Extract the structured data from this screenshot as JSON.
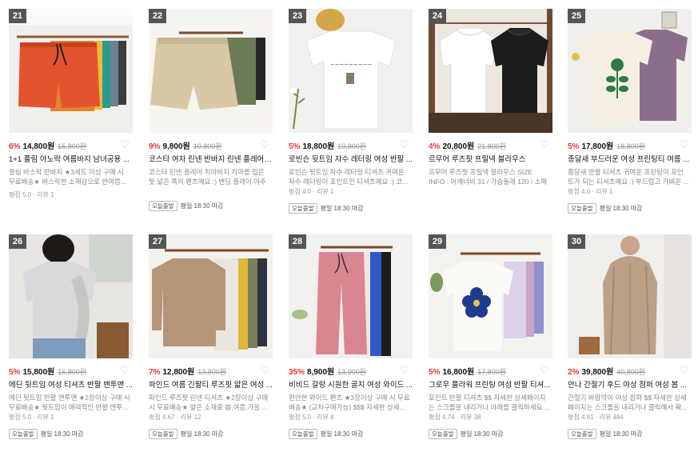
{
  "products": [
    {
      "rank": "21",
      "discount": "6%",
      "price": "14,800원",
      "original": "15,800원",
      "title": "1+1 플림 아노락 여름바지 남녀공용 ...",
      "desc": "플림 바스락 반바지 ★3세트 이상 구매 시 무료배송★ 바스락한 소재감으로 한여름...",
      "rating": "평점 5.0 · 리뷰 1",
      "badge": "",
      "delivery": ""
    },
    {
      "rank": "22",
      "discount": "9%",
      "price": "9,800원",
      "original": "10,800원",
      "title": "코스타 여자 린넨 반바지 린넨 플레어 치마...",
      "desc": "코스타 린넨 플레어 치마바지 치마를 입은 듯 넓은 폭의 팬츠예요 :) 밴딩 플레어 아주 ...",
      "rating": "",
      "badge": "오늘출발",
      "delivery": "평일 18:30 마감"
    },
    {
      "rank": "23",
      "discount": "5%",
      "price": "18,800원",
      "original": "19,800원",
      "title": "로빈슨 뒷트임 자수 레터링 여성 반팔 ...",
      "desc": "로빈슨 뒷트임 자수 레터링 티셔츠 귀여운 자수 레터링이 포인트인 티셔츠예요 :) 코...",
      "rating": "평점 4.0 · 리뷰 1",
      "badge": "오늘출발",
      "delivery": "평일 18:30 마감"
    },
    {
      "rank": "24",
      "discount": "4%",
      "price": "20,800원",
      "original": "21,800원",
      "title": "르무어 루즈핏 프릴넥 블라우스",
      "desc": "르무어 루즈핏 프릴넥 블라우스 SIZE INFO : 어깨너비 31 / 가슴둘레 120 / 소매길이 ...",
      "rating": "",
      "badge": "",
      "delivery": ""
    },
    {
      "rank": "25",
      "discount": "5%",
      "price": "17,800원",
      "original": "18,800원",
      "title": "종달새 부드러운 여성 프린팅티 여름 ...",
      "desc": "종달새 반팔 티셔츠 귀여운 프린팅이 포인트가 되는 티셔츠예요 :) 부드럽고 가벼운 ...",
      "rating": "평점 4.0 · 리뷰 1",
      "badge": "오늘출발",
      "delivery": "평일 18:30 마감"
    },
    {
      "rank": "26",
      "discount": "5%",
      "price": "15,800원",
      "original": "16,800원",
      "title": "에딘 뒷트임 여성 티셔츠 반팔 맨투맨 ...",
      "desc": "에딘 뒷트임 반팔 맨투맨 ★2장이상 구매 시 무료배송★ 뒷트임이 매력적인 반팔 맨투...",
      "rating": "평점 5.0 · 리뷰 1",
      "badge": "오늘출발",
      "delivery": "평일 18:30 마감"
    },
    {
      "rank": "27",
      "discount": "7%",
      "price": "12,800원",
      "original": "13,800원",
      "title": "파인드 여름 긴팔티 루즈핏 얇은 여성 ...",
      "desc": "파인드 루즈핏 린넨 티셔츠 ★2장이상 구매 시 무료배송★ 얇은 소재로 봄,여름,가을 ...",
      "rating": "평점 4.67 · 리뷰 12",
      "badge": "오늘출발",
      "delivery": "평일 18:30 마감"
    },
    {
      "rank": "28",
      "discount": "35%",
      "price": "8,900원",
      "original": "13,900원",
      "title": "비비드 갈랑 시원한 골지 여성 와이드 ...",
      "desc": "편안한 와이드 팬츠 ★3장이상 구매 시 무료배송★ (교차구매가능) $$$ 자세한 상세...",
      "rating": "평점 5.0 · 리뷰 8",
      "badge": "오늘출발",
      "delivery": "평일 18:30 마감"
    },
    {
      "rank": "29",
      "discount": "5%",
      "price": "16,800원",
      "original": "17,800원",
      "title": "그로우 플라워 프린팅 여성 반팔 티셔...",
      "desc": "포인트 반팔 티셔츠 $$ 자세한 상세페이지는 스크롤을 내리거나 아래를 클릭하세요 ...",
      "rating": "평점 4.74 · 리뷰 38",
      "badge": "오늘출발",
      "delivery": "평일 18:30 마감"
    },
    {
      "rank": "30",
      "discount": "2%",
      "price": "39,800원",
      "original": "40,800원",
      "title": "안나 간절기 후드 야상 점퍼 여성 봄 ...",
      "desc": "간절기 바람막이 야상 점퍼 $$ 자세한 상세페이지는 스크롤을 내리거나 클릭해서 확...",
      "rating": "평점 4.81 · 리뷰 484",
      "badge": "오늘출발",
      "delivery": "평일 18:30 마감"
    }
  ]
}
